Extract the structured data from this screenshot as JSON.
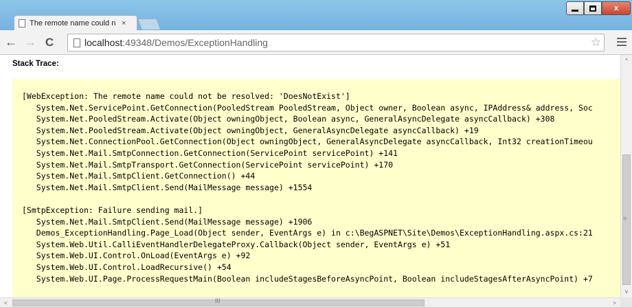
{
  "tab": {
    "title": "The remote name could n",
    "close": "×"
  },
  "nav": {
    "back": "←",
    "forward": "→",
    "reload": "C"
  },
  "address": {
    "host": "localhost",
    "rest": ":49348/Demos/ExceptionHandling"
  },
  "toolbar": {
    "star": "☆"
  },
  "window": {
    "close": "x"
  },
  "page": {
    "stack_label": "Stack Trace:",
    "trace": [
      "[WebException: The remote name could not be resolved: 'DoesNotExist']",
      "   System.Net.ServicePoint.GetConnection(PooledStream PooledStream, Object owner, Boolean async, IPAddress& address, Soc",
      "   System.Net.PooledStream.Activate(Object owningObject, Boolean async, GeneralAsyncDelegate asyncCallback) +308",
      "   System.Net.PooledStream.Activate(Object owningObject, GeneralAsyncDelegate asyncCallback) +19",
      "   System.Net.ConnectionPool.GetConnection(Object owningObject, GeneralAsyncDelegate asyncCallback, Int32 creationTimeou",
      "   System.Net.Mail.SmtpConnection.GetConnection(ServicePoint servicePoint) +141",
      "   System.Net.Mail.SmtpTransport.GetConnection(ServicePoint servicePoint) +170",
      "   System.Net.Mail.SmtpClient.GetConnection() +44",
      "   System.Net.Mail.SmtpClient.Send(MailMessage message) +1554",
      "",
      "[SmtpException: Failure sending mail.]",
      "   System.Net.Mail.SmtpClient.Send(MailMessage message) +1906",
      "   Demos_ExceptionHandling.Page_Load(Object sender, EventArgs e) in c:\\BegASPNET\\Site\\Demos\\ExceptionHandling.aspx.cs:21",
      "   System.Web.Util.CalliEventHandlerDelegateProxy.Callback(Object sender, EventArgs e) +51",
      "   System.Web.UI.Control.OnLoad(EventArgs e) +92",
      "   System.Web.UI.Control.LoadRecursive() +54",
      "   System.Web.UI.Page.ProcessRequestMain(Boolean includeStagesBeforeAsyncPoint, Boolean includeStagesAfterAsyncPoint) +7"
    ]
  },
  "scroll": {
    "up": "^",
    "down": "v",
    "left": "<",
    "right": ">",
    "vgrip": "≡",
    "hgrip": "III"
  }
}
